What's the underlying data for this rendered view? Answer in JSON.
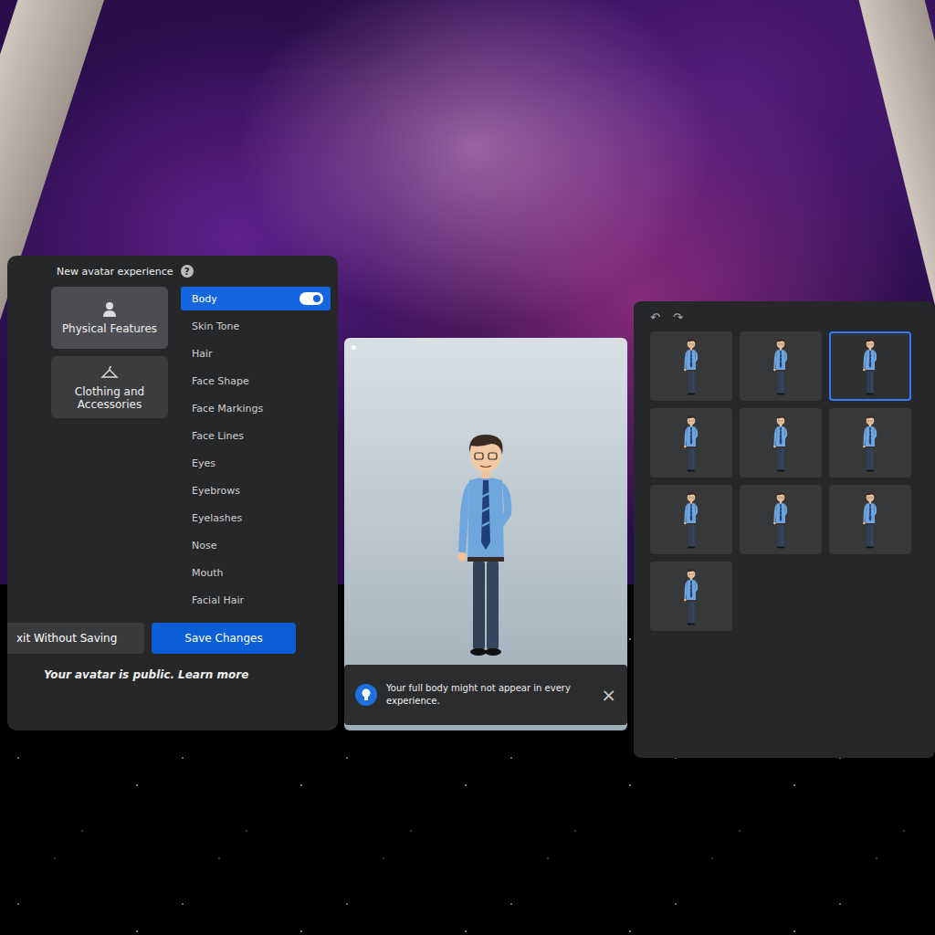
{
  "panel_title": "New avatar experience",
  "help_icon": "?",
  "categories": [
    {
      "label": "Physical Features",
      "selected": true
    },
    {
      "label": "Clothing and Accessories",
      "selected": false
    }
  ],
  "body_toggle": {
    "on": true
  },
  "features": [
    {
      "label": "Body",
      "selected": true
    },
    {
      "label": "Skin Tone",
      "selected": false
    },
    {
      "label": "Hair",
      "selected": false
    },
    {
      "label": "Face Shape",
      "selected": false
    },
    {
      "label": "Face Markings",
      "selected": false
    },
    {
      "label": "Face Lines",
      "selected": false
    },
    {
      "label": "Eyes",
      "selected": false
    },
    {
      "label": "Eyebrows",
      "selected": false
    },
    {
      "label": "Eyelashes",
      "selected": false
    },
    {
      "label": "Nose",
      "selected": false
    },
    {
      "label": "Mouth",
      "selected": false
    },
    {
      "label": "Facial Hair",
      "selected": false
    }
  ],
  "buttons": {
    "exit": "xit Without Saving",
    "save": "Save Changes"
  },
  "footer": {
    "text": "Your avatar is public.",
    "link": "Learn more"
  },
  "notice": {
    "text": "Your full body might not appear in every experience.",
    "close": "×"
  },
  "history": {
    "undo": "↶",
    "redo": "↷"
  },
  "body_options": [
    {
      "selected": false
    },
    {
      "selected": false
    },
    {
      "selected": true
    },
    {
      "selected": false
    },
    {
      "selected": false
    },
    {
      "selected": false
    },
    {
      "selected": false
    },
    {
      "selected": false
    },
    {
      "selected": false
    },
    {
      "selected": false
    }
  ]
}
